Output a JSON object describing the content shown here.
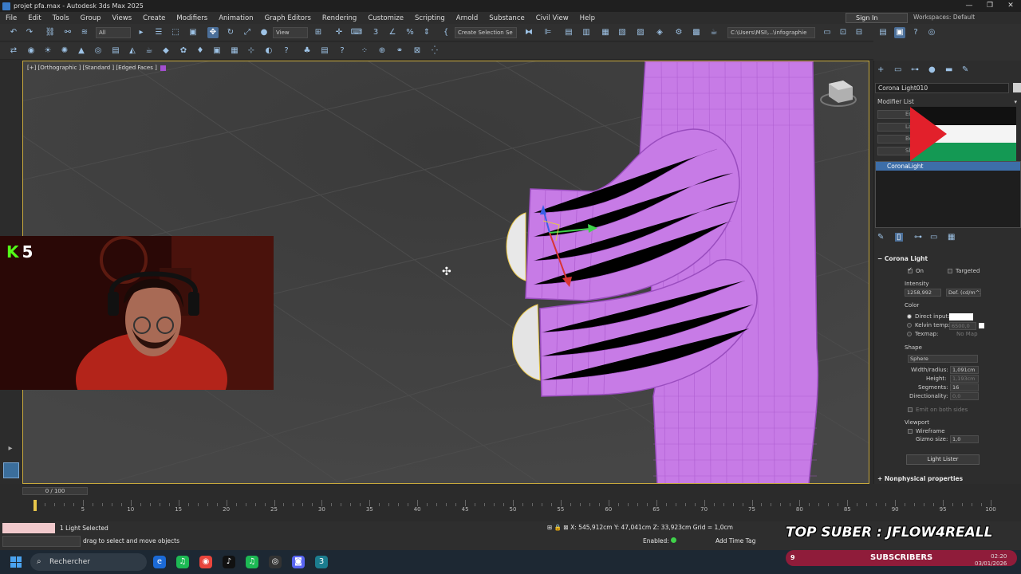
{
  "window": {
    "title": "projet pfa.max - Autodesk 3ds Max 2025",
    "controls": [
      "—",
      "❐",
      "✕"
    ]
  },
  "menu": {
    "items": [
      "File",
      "Edit",
      "Tools",
      "Group",
      "Views",
      "Create",
      "Modifiers",
      "Animation",
      "Graph Editors",
      "Rendering",
      "Customize",
      "Scripting",
      "Arnold",
      "Substance",
      "Civil View",
      "Help"
    ],
    "sign_in": "Sign In",
    "workspaces_label": "Workspaces:",
    "workspace_value": "Default"
  },
  "toolbar": {
    "filter_value": "All",
    "view_value": "View",
    "selection_set_placeholder": "Create Selection Se",
    "project_path": "C:\\Users\\MSI\\...\\infographie"
  },
  "viewport": {
    "label": "[+] [Orthographic ] [Standard ] [Edged Faces ]",
    "border_color": "#c8a93c",
    "object_color": "#c77be6"
  },
  "webcam": {
    "platform_icon": "kick-logo",
    "count": "5"
  },
  "command_panel": {
    "object_name": "Corona Light010",
    "modifier_list": "Modifier List",
    "modifier_buttons": [
      "Edit...",
      "Lat...",
      "Ben...",
      "She..."
    ],
    "stack_item": "CoronaLight",
    "rollout_title": "Corona Light",
    "on_label": "On",
    "targeted_label": "Targeted",
    "intensity_label": "Intensity",
    "intensity_value": "1258,992",
    "intensity_unit": "Def. (cd/m^2)",
    "color_label": "Color",
    "direct_input_label": "Direct input:",
    "kelvin_label": "Kelvin temp:",
    "kelvin_value": "6500,0",
    "texmap_label": "Texmap:",
    "texmap_value": "No Map",
    "shape_label": "Shape",
    "shape_value": "Sphere",
    "width_label": "Width/radius:",
    "width_value": "1,091cm",
    "height_label": "Height:",
    "height_value": "1,193cm",
    "segments_label": "Segments:",
    "segments_value": "16",
    "directionality_label": "Directionality:",
    "directionality_value": "0,0",
    "emit_label": "Emit on both sides",
    "viewport_label": "Viewport",
    "wireframe_label": "Wireframe",
    "gizmo_label": "Gizmo size:",
    "gizmo_value": "1,0",
    "light_lister": "Light Lister",
    "nonphysical": "Nonphysical properties"
  },
  "timeline": {
    "frame_range": "0 / 100",
    "ticks": [
      "0",
      "5",
      "10",
      "15",
      "20",
      "25",
      "30",
      "35",
      "40",
      "45",
      "50",
      "55",
      "60",
      "65",
      "70",
      "75",
      "80",
      "85",
      "90",
      "95",
      "100"
    ],
    "current_frame": 0
  },
  "status": {
    "selection": "1 Light Selected",
    "prompt": "drag to select and move objects",
    "x_label": "X:",
    "x_value": "545,912cm",
    "y_label": "Y:",
    "y_value": "47,041cm",
    "z_label": "Z:",
    "z_value": "33,923cm",
    "grid": "Grid = 1,0cm",
    "enabled": "Enabled:",
    "add_time_tag": "Add Time Tag",
    "overlay": "TOP SUBER : JFLOW4REALL"
  },
  "taskbar": {
    "search": "Rechercher",
    "subscribers_count": "9",
    "subscribers_label": "SUBSCRIBERS",
    "time": "02:20",
    "date": "03/01/2026"
  }
}
